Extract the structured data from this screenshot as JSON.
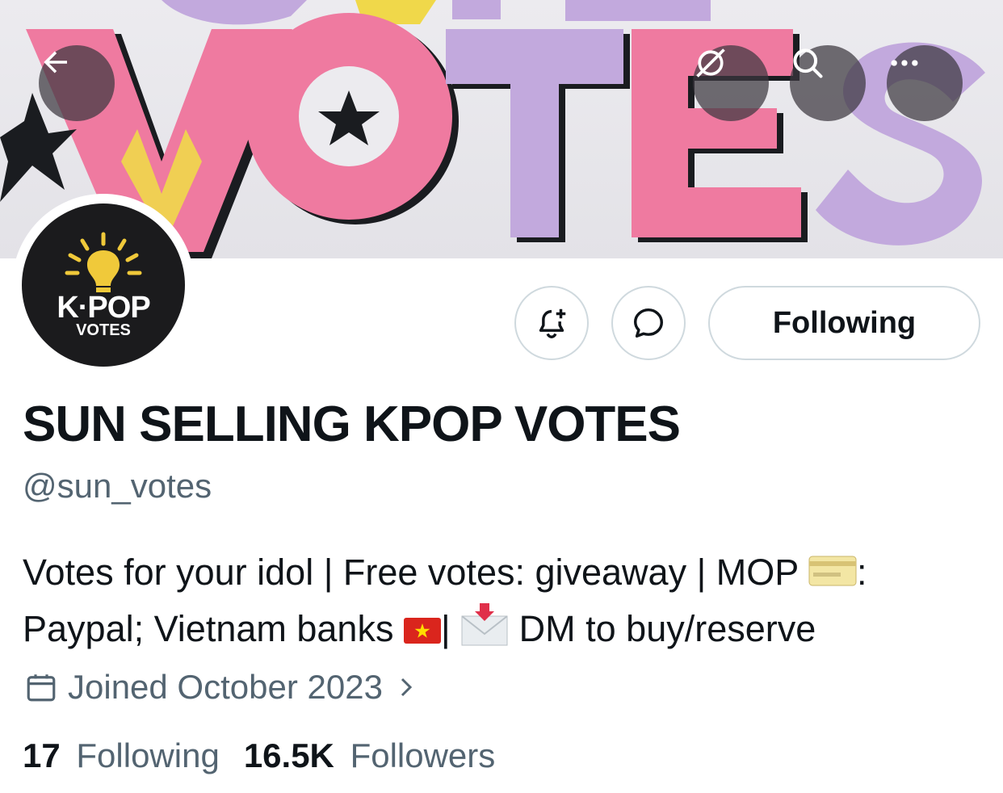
{
  "banner": {
    "image_text": "VOTES",
    "colors": {
      "pink": "#ef7aa0",
      "lilac": "#c2a9dd",
      "yellow": "#f0d84a",
      "ink": "#1a1c20"
    }
  },
  "header_actions": {
    "back_icon": "arrow-left-icon",
    "grok_icon": "slashed-circle-icon",
    "search_icon": "search-icon",
    "more_icon": "more-dots-icon"
  },
  "avatar": {
    "logo_line1": "K·POP",
    "logo_line2": "VOTES"
  },
  "profile_actions": {
    "notify_icon": "bell-plus-icon",
    "message_icon": "chat-bubble-icon",
    "following_label": "Following"
  },
  "profile": {
    "display_name": "SUN SELLING KPOP VOTES",
    "handle": "@sun_votes",
    "bio": {
      "part1": "Votes for your idol | Free votes: giveaway | MOP ",
      "part2": ":",
      "part3": "Paypal; Vietnam banks ",
      "part4": "| ",
      "part5": " DM to buy/reserve"
    },
    "joined": "Joined October 2023"
  },
  "stats": {
    "following_count": "17",
    "following_label": "Following",
    "followers_count": "16.5K",
    "followers_label": "Followers"
  },
  "colors": {
    "text_primary": "#0f1419",
    "text_secondary": "#536471",
    "border": "#cfd9de"
  }
}
